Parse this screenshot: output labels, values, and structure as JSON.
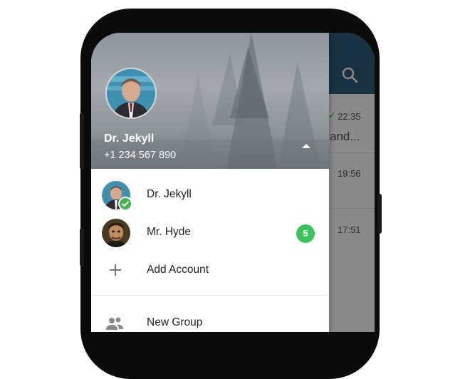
{
  "drawer": {
    "user_name": "Dr. Jekyll",
    "user_phone": "+1 234 567 890",
    "accounts": [
      {
        "label": "Dr. Jekyll",
        "active": true
      },
      {
        "label": "Mr. Hyde",
        "unread": "5"
      }
    ],
    "add_account_label": "Add Account",
    "menu_items": [
      {
        "label": "New Group",
        "icon": "group-icon"
      }
    ]
  },
  "chat_list": {
    "times": [
      "22:35",
      "19:56",
      "17:51"
    ],
    "snippet": "and..."
  },
  "colors": {
    "toolbar": "#2f5d79",
    "badge_green": "#3cc25b",
    "check_green": "#3fb34f"
  }
}
